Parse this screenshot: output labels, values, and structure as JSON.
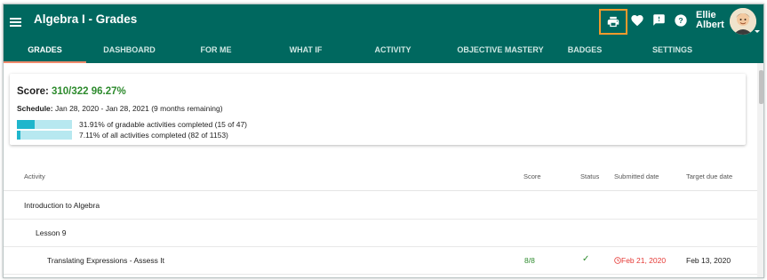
{
  "app": {
    "title": "Algebra I - Grades",
    "user": {
      "first": "Ellie",
      "last": "Albert"
    }
  },
  "tabs": [
    {
      "label": "GRADES",
      "active": true
    },
    {
      "label": "DASHBOARD"
    },
    {
      "label": "FOR ME"
    },
    {
      "label": "WHAT IF"
    },
    {
      "label": "ACTIVITY"
    },
    {
      "label": "OBJECTIVE MASTERY"
    },
    {
      "label": "BADGES"
    },
    {
      "label": "SETTINGS"
    }
  ],
  "icons": {
    "print": "print-icon",
    "favorite": "heart-icon",
    "feedback": "feedback-icon",
    "help": "help-icon",
    "menu": "hamburger-menu-icon"
  },
  "score": {
    "label": "Score:",
    "value": "310/322 96.27%"
  },
  "schedule": {
    "label": "Schedule:",
    "text": "Jan 28, 2020 - Jan 28, 2021 (9 months remaining)"
  },
  "progress": [
    {
      "text": "31.91% of gradable activities completed (15 of 47)",
      "fraction": 0.3191
    },
    {
      "text": "7.11% of all activities completed (82 of 1153)",
      "fraction": 0.0711
    }
  ],
  "table": {
    "headers": {
      "activity": "Activity",
      "score": "Score",
      "status": "Status",
      "submitted": "Submitted date",
      "target": "Target due date"
    },
    "rows": [
      {
        "activity": "Introduction to Algebra",
        "level": 0
      },
      {
        "activity": "Lesson 9",
        "level": 1
      },
      {
        "activity": "Translating Expressions - Assess It",
        "level": 2,
        "score": "8/8",
        "status": "✓",
        "submitted": "Feb 21, 2020",
        "target": "Feb 13, 2020"
      }
    ]
  },
  "colors": {
    "appbar": "#00685f",
    "accent_print_outline": "#f39a2c",
    "score_green": "#2e8b2e",
    "late_red": "#e53935",
    "progress_fill": "#1fb6cc",
    "progress_track": "#b7e8f0"
  }
}
